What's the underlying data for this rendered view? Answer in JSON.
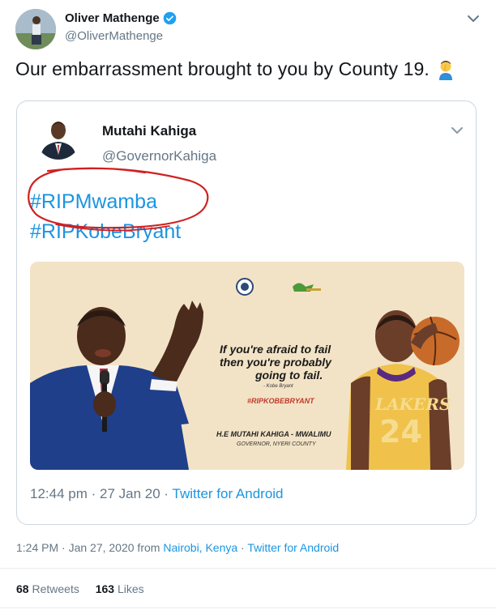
{
  "tweet": {
    "author_name": "Oliver Mathenge",
    "author_handle": "@OliverMathenge",
    "text": "Our embarrassment brought to you by County 19.",
    "emoji": "facepalm-emoji"
  },
  "quoted_tweet": {
    "author_name": "Mutahi Kahiga",
    "author_handle": "@GovernorKahiga",
    "hashtags": [
      "#RIPMwamba",
      "#RIPKobeBryant"
    ],
    "poster": {
      "quote_line1": "If you're afraid to fail",
      "quote_line2": "then you're probably",
      "quote_line3": "going to fail.",
      "attribution": "- Kobe Bryant",
      "tag": "#RIPKOBEBRYANT",
      "governor_line": "H.E MUTAHI KAHIGA - MWALIMU",
      "county_line": "GOVERNOR, NYERI COUNTY",
      "jersey_team": "LAKERS",
      "jersey_number": "24"
    },
    "meta": {
      "time": "12:44 pm",
      "sep1": " · ",
      "date": "27 Jan 20",
      "sep2": " · ",
      "source": "Twitter for Android"
    }
  },
  "meta": {
    "timestamp": "1:24 PM · Jan 27, 2020 from ",
    "location": "Nairobi, Kenya",
    "sep": " · ",
    "source": "Twitter for Android"
  },
  "stats": {
    "retweets_count": "68",
    "retweets_label": "Retweets",
    "likes_count": "163",
    "likes_label": "Likes"
  },
  "colors": {
    "link": "#1b95e0",
    "secondary_text": "#657786",
    "verified": "#1da1f2",
    "scribble": "#d02020"
  }
}
